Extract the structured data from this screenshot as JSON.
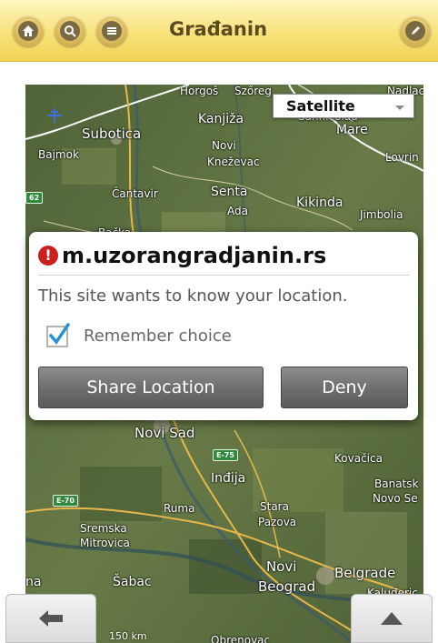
{
  "header": {
    "title": "Građanin",
    "buttons": {
      "home": "home-icon",
      "search": "search-icon",
      "menu": "menu-icon",
      "edit": "pencil-icon"
    }
  },
  "map": {
    "type_selector": "Satellite",
    "labels": {
      "horgos": "Horgoš",
      "szoreg": "Szőreg",
      "nadlac": "Nadlac",
      "subotica": "Subotica",
      "kanjiza": "Kanjiža",
      "sannicolau": "Sannicolau",
      "mare": "Mare",
      "bajmok": "Bajmok",
      "novi_knezevac": "Novi\nKneževac",
      "lovrin": "Lovrin",
      "cantavir": "Čantavir",
      "senta": "Senta",
      "ada": "Ada",
      "kikinda": "Kikinda",
      "jimbolia": "Jimbolia",
      "backa": "Bačka",
      "novi_sad": "Novi Sad",
      "kovacica": "Kovačica",
      "indjija": "Inđija",
      "banatsko": "Banatsk",
      "novo_se": "Novo Se",
      "ruma": "Ruma",
      "stara_pazova": "Stara\nPazova",
      "sremska_mitrovica": "Sremska\nMitrovica",
      "sabac": "Šabac",
      "novi_beograd": "Novi\nBeograd",
      "belgrade": "Belgrade",
      "kaluderica": "Kaluđeric",
      "na": "na",
      "obrenovac": "Obrenovac"
    },
    "roads": {
      "e75": "E-75",
      "e70": "E-70",
      "r62": "62"
    },
    "scale": "150 km",
    "colors": {
      "terrain": "#5b6e42",
      "road": "#e8b84a",
      "border": "#ffffff"
    }
  },
  "dialog": {
    "icon": "error-icon",
    "icon_glyph": "!",
    "title": "m.uzorangradjanin.rs",
    "message": "This site wants to know your location.",
    "remember_label": "Remember choice",
    "remember_checked": true,
    "share_button": "Share Location",
    "deny_button": "Deny"
  },
  "bottom_nav": {
    "back": "back-arrow-icon",
    "top": "scroll-top-icon"
  }
}
